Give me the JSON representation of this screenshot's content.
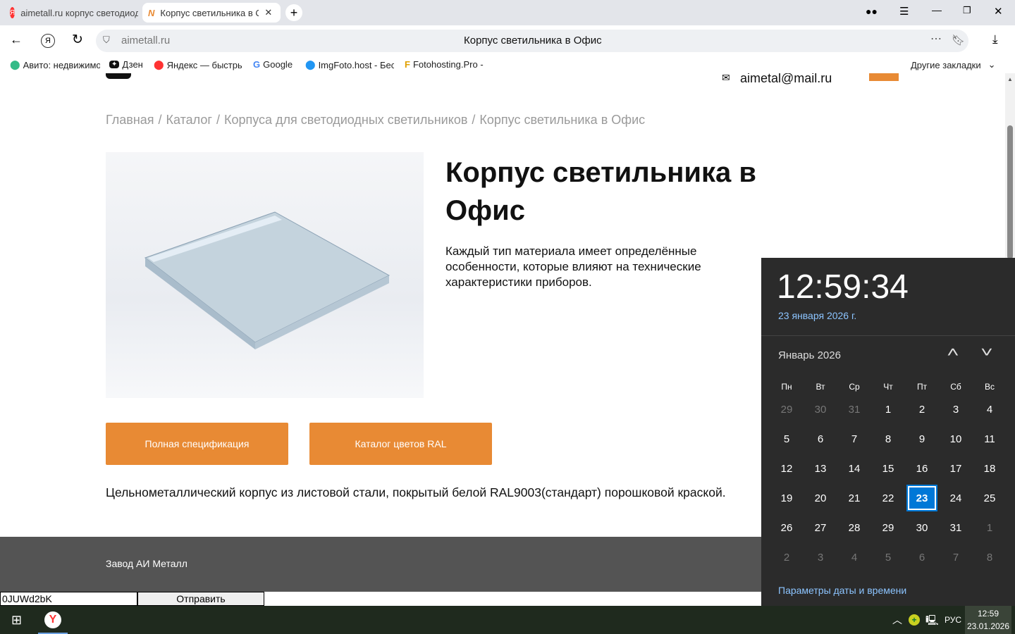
{
  "browser": {
    "tabs": [
      {
        "label": "aimetall.ru корпус светодиодных"
      },
      {
        "label": "Корпус светильника в Офис"
      }
    ],
    "url": "aimetall.ru",
    "page_title": "Корпус светильника в Офис",
    "bookmarks": [
      "Авито: недвижимость",
      "Дзен",
      "Яндекс — быстрый",
      "Google",
      "ImgFoto.host - Бесплатный",
      "Fotohosting.Pro - "
    ],
    "other_bookmarks": "Другие закладки"
  },
  "page": {
    "email": "aimetal@mail.ru",
    "breadcrumb": [
      "Главная",
      "/",
      "Каталог",
      "/",
      "Корпуса для светодиодных светильников",
      "/",
      "Корпус светильника в Офис"
    ],
    "title": "Корпус светильника в Офис",
    "description": "Каждый тип материала имеет определённые особенности, которые влияют на технические характеристики приборов.",
    "btn_spec": "Полная спецификация",
    "btn_ral": "Каталог цветов RAL",
    "body_text": "Цельнометаллический корпус из листовой стали, покрытый белой RAL9003(стандарт) порошковой краской.",
    "footer": "Завод АИ Металл",
    "form_value": "0JUWd2bK",
    "form_submit": "Отправить"
  },
  "calendar": {
    "time": "12:59:34",
    "date": "23 января 2026 г.",
    "month": "Январь 2026",
    "weekdays": [
      "Пн",
      "Вт",
      "Ср",
      "Чт",
      "Пт",
      "Сб",
      "Вс"
    ],
    "days": [
      29,
      30,
      31,
      1,
      2,
      3,
      4,
      5,
      6,
      7,
      8,
      9,
      10,
      11,
      12,
      13,
      14,
      15,
      16,
      17,
      18,
      19,
      20,
      21,
      22,
      23,
      24,
      25,
      26,
      27,
      28,
      29,
      30,
      31,
      1,
      2,
      3,
      4,
      5,
      6,
      7,
      8
    ],
    "current_month_range": [
      3,
      33
    ],
    "selected_index": 25,
    "settings_link": "Параметры даты и времени"
  },
  "taskbar": {
    "lang": "РУС",
    "time": "12:59",
    "date": "23.01.2026"
  },
  "colors": {
    "accent": "#e88a34",
    "cal_bg": "#2b2b2b",
    "cal_link": "#8cc4ff",
    "selected": "#0078d7"
  }
}
